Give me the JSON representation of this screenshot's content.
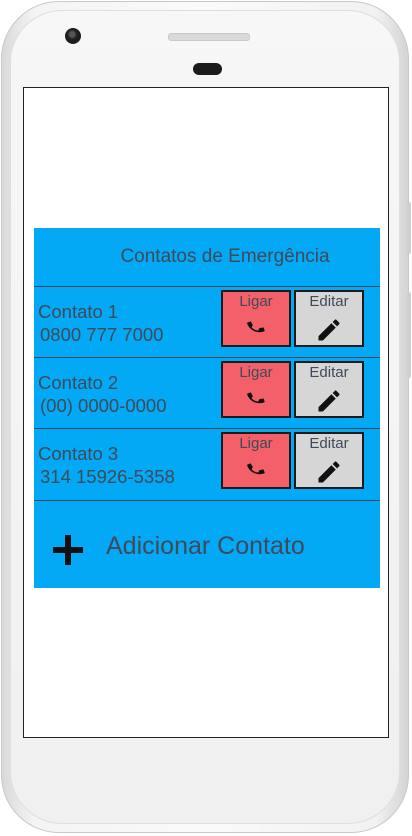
{
  "header": {
    "title": "Contatos de Emergência"
  },
  "contacts": [
    {
      "name": "Contato 1",
      "phone": "0800 777 7000",
      "call_label": "Ligar",
      "edit_label": "Editar"
    },
    {
      "name": "Contato 2",
      "phone": "(00) 0000-0000",
      "call_label": "Ligar",
      "edit_label": "Editar"
    },
    {
      "name": "Contato 3",
      "phone": "314 15926-5358",
      "call_label": "Ligar",
      "edit_label": "Editar"
    }
  ],
  "add_contact": {
    "label": "Adicionar Contato",
    "icon": "plus-icon"
  },
  "icons": {
    "call": "phone-icon",
    "edit": "pencil-icon"
  },
  "colors": {
    "panel": "#03a9f4",
    "call_button": "#f4606a",
    "edit_button": "#d6d6d6",
    "text": "#3f4a5a"
  }
}
